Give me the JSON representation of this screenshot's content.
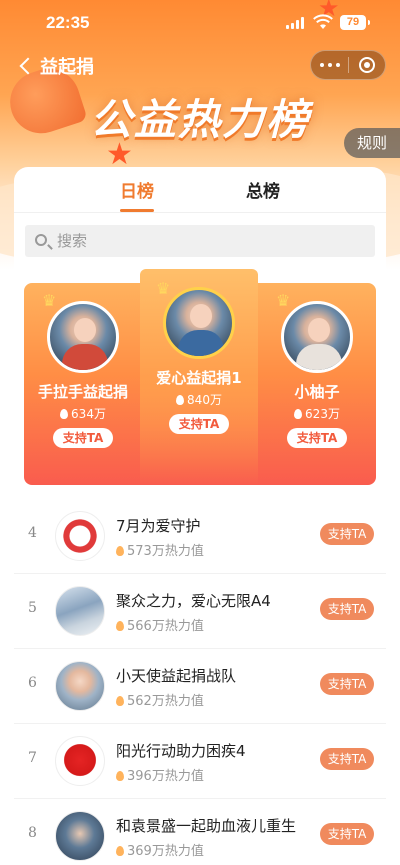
{
  "status_bar": {
    "time": "22:35",
    "battery": "79"
  },
  "nav": {
    "back_label": "益起捐"
  },
  "hero": {
    "title": "公益热力榜",
    "rules_label": "规则"
  },
  "tabs": [
    {
      "label": "日榜",
      "active": true
    },
    {
      "label": "总榜",
      "active": false
    }
  ],
  "search": {
    "placeholder": "搜索"
  },
  "top3": [
    {
      "rank": 2,
      "name": "手拉手益起捐",
      "heat": "634万",
      "button": "支持TA"
    },
    {
      "rank": 1,
      "name": "爱心益起捐1",
      "heat": "840万",
      "button": "支持TA"
    },
    {
      "rank": 3,
      "name": "小柚子",
      "heat": "623万",
      "button": "支持TA"
    }
  ],
  "list": [
    {
      "rank": "4",
      "title": "7月为爱守护",
      "heat": "573万热力值",
      "button": "支持TA"
    },
    {
      "rank": "5",
      "title": "聚众之力，爱心无限A4",
      "heat": "566万热力值",
      "button": "支持TA"
    },
    {
      "rank": "6",
      "title": "小天使益起捐战队",
      "heat": "562万热力值",
      "button": "支持TA"
    },
    {
      "rank": "7",
      "title": "阳光行动助力困疾4",
      "heat": "396万热力值",
      "button": "支持TA"
    },
    {
      "rank": "8",
      "title": "和袁景盛一起助血液儿重生",
      "heat": "369万热力值",
      "button": "支持TA"
    }
  ],
  "colors": {
    "accent": "#f07b2f",
    "button": "#f08a5d",
    "podium_bottom": "#f95c4e"
  }
}
